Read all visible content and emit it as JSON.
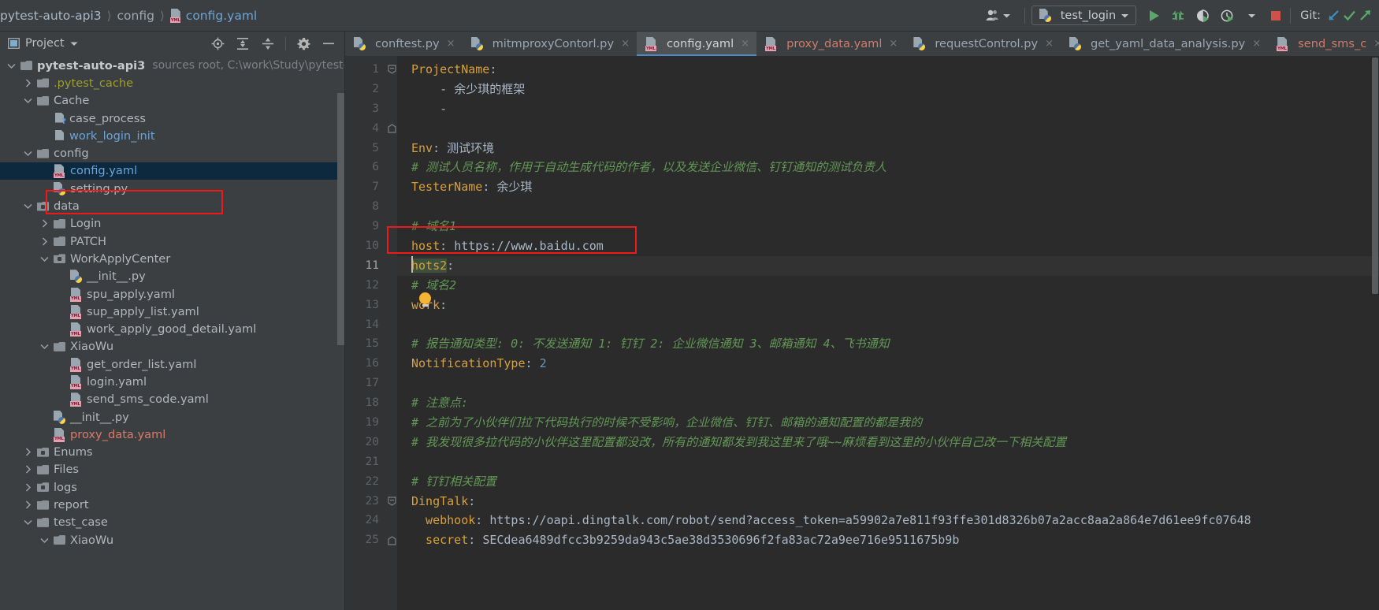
{
  "breadcrumb": {
    "project": "pytest-auto-api3",
    "folder": "config",
    "file": "config.yaml"
  },
  "toolbar": {
    "user_icon": "user-group-icon",
    "run_config": "test_login",
    "run_label": "run-icon",
    "debug_label": "debug-icon",
    "coverage_label": "coverage-icon",
    "profile_label": "profile-icon",
    "stop_label": "stop-icon",
    "git_label": "Git:",
    "git_update": "update-project-icon",
    "git_commit": "commit-icon",
    "git_push": "push-icon"
  },
  "project_panel": {
    "title": "Project",
    "icons": [
      "locate-icon",
      "expand-all-icon",
      "collapse-all-icon",
      "settings-gear-icon",
      "hide-icon"
    ],
    "tree": [
      {
        "depth": 0,
        "arrow": "down",
        "icon": "folder",
        "label": "pytest-auto-api3",
        "style": "bold",
        "meta": "sources root,  C:\\work\\Study\\pytest-auto"
      },
      {
        "depth": 1,
        "arrow": "right",
        "icon": "folder",
        "label": ".pytest_cache",
        "style": "olive",
        "meta": ""
      },
      {
        "depth": 1,
        "arrow": "down",
        "icon": "folder",
        "label": "Cache",
        "style": "plain",
        "meta": ""
      },
      {
        "depth": 2,
        "arrow": "none",
        "icon": "txt-q",
        "label": "case_process",
        "style": "plain",
        "meta": ""
      },
      {
        "depth": 2,
        "arrow": "none",
        "icon": "txt",
        "label": "work_login_init",
        "style": "blue",
        "meta": ""
      },
      {
        "depth": 1,
        "arrow": "down",
        "icon": "folder",
        "label": "config",
        "style": "plain",
        "meta": ""
      },
      {
        "depth": 2,
        "arrow": "none",
        "icon": "yml",
        "label": "config.yaml",
        "style": "blue",
        "meta": "",
        "selected": true
      },
      {
        "depth": 2,
        "arrow": "none",
        "icon": "py",
        "label": "setting.py",
        "style": "plain",
        "meta": ""
      },
      {
        "depth": 1,
        "arrow": "down",
        "icon": "folder-src",
        "label": "data",
        "style": "plain",
        "meta": ""
      },
      {
        "depth": 2,
        "arrow": "right",
        "icon": "folder",
        "label": "Login",
        "style": "plain",
        "meta": ""
      },
      {
        "depth": 2,
        "arrow": "right",
        "icon": "folder",
        "label": "PATCH",
        "style": "plain",
        "meta": ""
      },
      {
        "depth": 2,
        "arrow": "down",
        "icon": "folder-src",
        "label": "WorkApplyCenter",
        "style": "plain",
        "meta": ""
      },
      {
        "depth": 3,
        "arrow": "none",
        "icon": "py",
        "label": "__init__.py",
        "style": "plain",
        "meta": ""
      },
      {
        "depth": 3,
        "arrow": "none",
        "icon": "yml",
        "label": "spu_apply.yaml",
        "style": "plain",
        "meta": ""
      },
      {
        "depth": 3,
        "arrow": "none",
        "icon": "yml",
        "label": "sup_apply_list.yaml",
        "style": "plain",
        "meta": ""
      },
      {
        "depth": 3,
        "arrow": "none",
        "icon": "yml",
        "label": "work_apply_good_detail.yaml",
        "style": "plain",
        "meta": ""
      },
      {
        "depth": 2,
        "arrow": "down",
        "icon": "folder",
        "label": "XiaoWu",
        "style": "plain",
        "meta": ""
      },
      {
        "depth": 3,
        "arrow": "none",
        "icon": "yml",
        "label": "get_order_list.yaml",
        "style": "plain",
        "meta": ""
      },
      {
        "depth": 3,
        "arrow": "none",
        "icon": "yml",
        "label": "login.yaml",
        "style": "plain",
        "meta": ""
      },
      {
        "depth": 3,
        "arrow": "none",
        "icon": "yml",
        "label": "send_sms_code.yaml",
        "style": "plain",
        "meta": ""
      },
      {
        "depth": 2,
        "arrow": "none",
        "icon": "py",
        "label": "__init__.py",
        "style": "plain",
        "meta": ""
      },
      {
        "depth": 2,
        "arrow": "none",
        "icon": "yml",
        "label": "proxy_data.yaml",
        "style": "red",
        "meta": ""
      },
      {
        "depth": 1,
        "arrow": "right",
        "icon": "folder-src",
        "label": "Enums",
        "style": "plain",
        "meta": ""
      },
      {
        "depth": 1,
        "arrow": "right",
        "icon": "folder",
        "label": "Files",
        "style": "plain",
        "meta": ""
      },
      {
        "depth": 1,
        "arrow": "right",
        "icon": "folder-src",
        "label": "logs",
        "style": "plain",
        "meta": ""
      },
      {
        "depth": 1,
        "arrow": "right",
        "icon": "folder",
        "label": "report",
        "style": "plain",
        "meta": ""
      },
      {
        "depth": 1,
        "arrow": "down",
        "icon": "folder",
        "label": "test_case",
        "style": "plain",
        "meta": ""
      },
      {
        "depth": 2,
        "arrow": "down",
        "icon": "folder",
        "label": "XiaoWu",
        "style": "plain",
        "meta": ""
      }
    ]
  },
  "editor": {
    "tabs": [
      {
        "label": "conftest.py",
        "icon": "py",
        "active": false
      },
      {
        "label": "mitmproxyContorl.py",
        "icon": "py",
        "active": false
      },
      {
        "label": "config.yaml",
        "icon": "yml",
        "active": true
      },
      {
        "label": "proxy_data.yaml",
        "icon": "yml",
        "active": false
      },
      {
        "label": "requestControl.py",
        "icon": "py",
        "active": false
      },
      {
        "label": "get_yaml_data_analysis.py",
        "icon": "py",
        "active": false
      },
      {
        "label": "send_sms_c",
        "icon": "yml",
        "active": false
      }
    ],
    "close_glyph": "×",
    "line_numbers": [
      1,
      2,
      3,
      4,
      5,
      6,
      7,
      8,
      9,
      10,
      11,
      12,
      13,
      14,
      15,
      16,
      17,
      18,
      19,
      20,
      21,
      22,
      23,
      24,
      25
    ],
    "current_line": 11,
    "lines": [
      {
        "n": 1,
        "segs": [
          {
            "t": "ProjectName",
            "c": "k"
          },
          {
            "t": ":",
            "c": "p"
          }
        ],
        "fold": "start"
      },
      {
        "n": 2,
        "segs": [
          {
            "t": "    - ",
            "c": "p"
          },
          {
            "t": "余少琪的框架",
            "c": "v"
          }
        ]
      },
      {
        "n": 3,
        "segs": [
          {
            "t": "    -",
            "c": "p"
          }
        ]
      },
      {
        "n": 4,
        "segs": [],
        "fold": "end"
      },
      {
        "n": 5,
        "segs": [
          {
            "t": "Env",
            "c": "k"
          },
          {
            "t": ": ",
            "c": "p"
          },
          {
            "t": "测试环境",
            "c": "v"
          }
        ]
      },
      {
        "n": 6,
        "segs": [
          {
            "t": "# 测试人员名称，作用于自动生成代码的作者，以及发送企业微信、钉钉通知的测试负责人",
            "c": "c"
          }
        ]
      },
      {
        "n": 7,
        "segs": [
          {
            "t": "TesterName",
            "c": "k"
          },
          {
            "t": ": ",
            "c": "p"
          },
          {
            "t": "余少琪",
            "c": "v"
          }
        ]
      },
      {
        "n": 8,
        "segs": []
      },
      {
        "n": 9,
        "segs": [
          {
            "t": "# 域名1",
            "c": "c"
          }
        ]
      },
      {
        "n": 10,
        "segs": [
          {
            "t": "host",
            "c": "k"
          },
          {
            "t": ": ",
            "c": "p"
          },
          {
            "t": "https://www.baidu.com",
            "c": "v"
          }
        ]
      },
      {
        "n": 11,
        "segs": [
          {
            "t": "hots2",
            "c": "k hl"
          },
          {
            "t": ":",
            "c": "p"
          }
        ]
      },
      {
        "n": 12,
        "segs": [
          {
            "t": "# 域名2",
            "c": "c"
          }
        ]
      },
      {
        "n": 13,
        "segs": [
          {
            "t": "work",
            "c": "k"
          },
          {
            "t": ":",
            "c": "p"
          }
        ]
      },
      {
        "n": 14,
        "segs": []
      },
      {
        "n": 15,
        "segs": [
          {
            "t": "# 报告通知类型: 0: 不发送通知 1: 钉钉 2: 企业微信通知 3、邮箱通知 4、飞书通知",
            "c": "c"
          }
        ]
      },
      {
        "n": 16,
        "segs": [
          {
            "t": "NotificationType",
            "c": "k"
          },
          {
            "t": ": ",
            "c": "p"
          },
          {
            "t": "2",
            "c": "num"
          }
        ]
      },
      {
        "n": 17,
        "segs": []
      },
      {
        "n": 18,
        "segs": [
          {
            "t": "# 注意点:",
            "c": "c"
          }
        ]
      },
      {
        "n": 19,
        "segs": [
          {
            "t": "# 之前为了小伙伴们拉下代码执行的时候不受影响，企业微信、钉钉、邮箱的通知配置的都是我的",
            "c": "c"
          }
        ]
      },
      {
        "n": 20,
        "segs": [
          {
            "t": "# 我发现很多拉代码的小伙伴这里配置都没改，所有的通知都发到我这里来了哦~~麻烦看到这里的小伙伴自己改一下相关配置",
            "c": "c"
          }
        ]
      },
      {
        "n": 21,
        "segs": []
      },
      {
        "n": 22,
        "segs": [
          {
            "t": "# 钉钉相关配置",
            "c": "c"
          }
        ]
      },
      {
        "n": 23,
        "segs": [
          {
            "t": "DingTalk",
            "c": "k"
          },
          {
            "t": ":",
            "c": "p"
          }
        ],
        "fold": "start"
      },
      {
        "n": 24,
        "segs": [
          {
            "t": "  webhook",
            "c": "k"
          },
          {
            "t": ": ",
            "c": "p"
          },
          {
            "t": "https://oapi.dingtalk.com/robot/send?access_token=a59902a7e811f93ffe301d8326b07a2acc8aa2a864e7d61ee9fc07648",
            "c": "v"
          }
        ]
      },
      {
        "n": 25,
        "segs": [
          {
            "t": "  secret",
            "c": "k"
          },
          {
            "t": ": ",
            "c": "p"
          },
          {
            "t": "SECdea6489dfcc3b9259da943c5ae38d3530696f2fa83ac72a9ee716e9511675b9b",
            "c": "v"
          }
        ],
        "fold": "end"
      }
    ]
  },
  "colors": {
    "accent_blue": "#4a88c7",
    "highlight_red": "#f11818",
    "selection_blue": "#0d293e",
    "editor_bg": "#2b2b2b",
    "panel_bg": "#3c3f41",
    "keyword_orange": "#d8a03d",
    "comment_green": "#629755",
    "search_hl_green": "#3c503c"
  }
}
